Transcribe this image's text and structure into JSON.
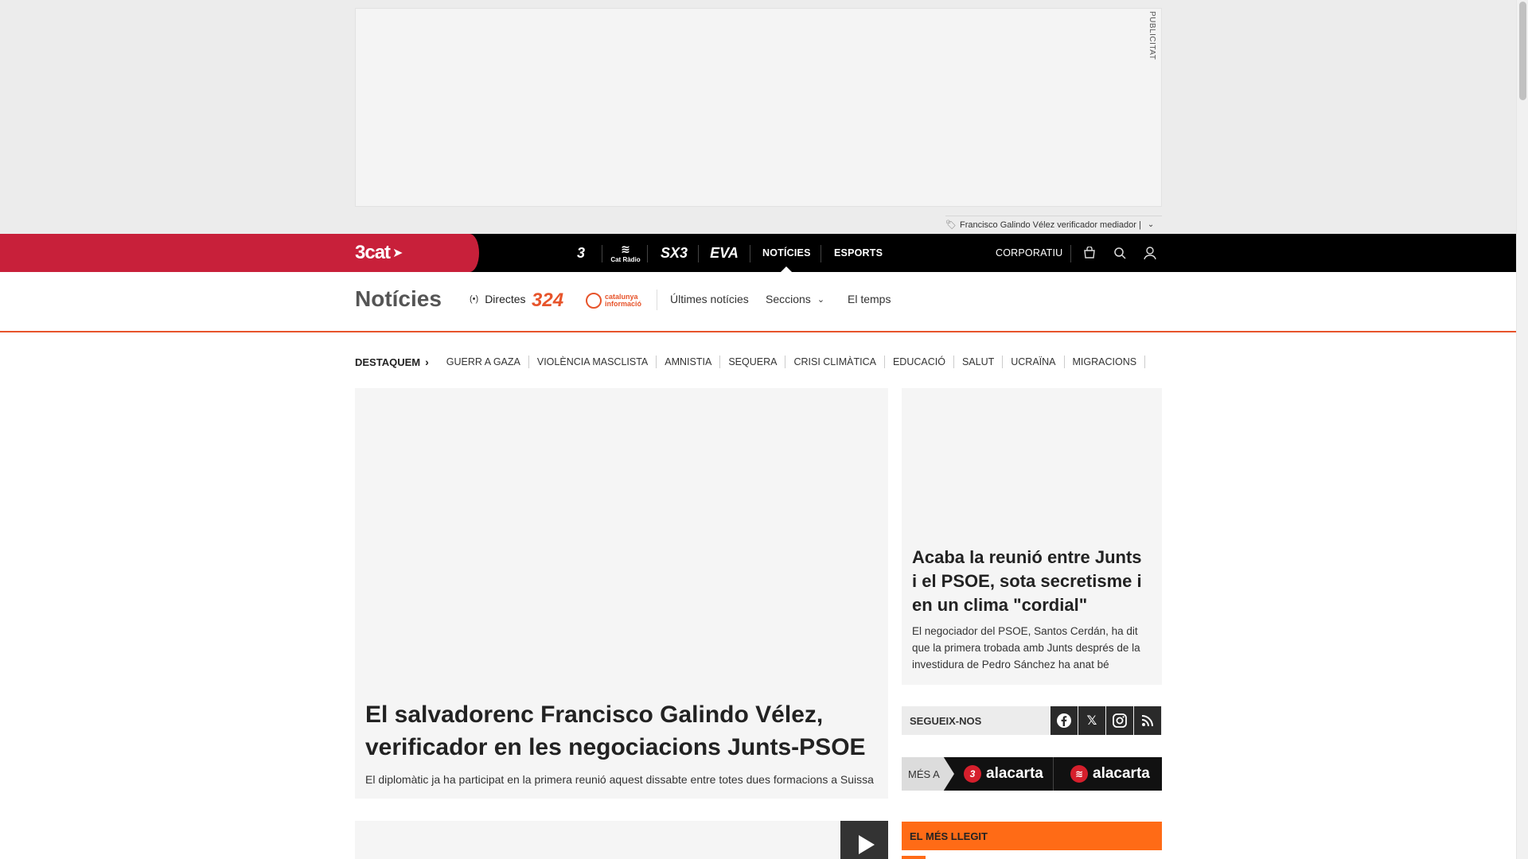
{
  "ad": {
    "label": "PUBLICITAT",
    "tag_text": "Francisco Galindo Vélez verificador mediador |",
    "tag_chevron": "chevron-down-icon"
  },
  "topnav": {
    "brand": "3cat",
    "channels": [
      "3",
      "Cat Ràdio",
      "SX3",
      "EVA"
    ],
    "links": [
      {
        "label": "NOTÍCIES",
        "active": true
      },
      {
        "label": "ESPORTS",
        "active": false
      }
    ],
    "corporate": "CORPORATIU",
    "icons": [
      "shop-icon",
      "search-icon",
      "user-icon"
    ]
  },
  "section": {
    "title": "Notícies",
    "live_label": "Directes",
    "logo_324": "324",
    "logo_ci_line1": "catalunya",
    "logo_ci_line2": "informació",
    "links": [
      "Últimes notícies",
      "Seccions",
      "El temps"
    ]
  },
  "highlights": {
    "title": "DESTAQUEM",
    "items": [
      "GUERR A GAZA",
      "VIOLÈNCIA MASCLISTA",
      "AMNISTIA",
      "SEQUERA",
      "CRISI CLIMÀTICA",
      "EDUCACIÓ",
      "SALUT",
      "UCRAÏNA",
      "MIGRACIONS"
    ]
  },
  "main_article": {
    "headline": "El salvadorenc Francisco Galindo Vélez, verificador en les negociacions Junts-PSOE",
    "summary": "El diplomàtic ja ha participat en la primera reunió aquest dissabte entre totes dues formacions a Suissa"
  },
  "side_article": {
    "headline": "Acaba la reunió entre Junts i el PSOE, sota secretisme i en un clima \"cordial\"",
    "summary": "El negociador del PSOE, Santos Cerdán, ha dit que la primera trobada amb Junts després de la investidura de Pedro Sánchez ha anat bé"
  },
  "follow": {
    "label": "SEGUEIX-NOS",
    "networks": [
      "facebook-icon",
      "x-icon",
      "instagram-icon",
      "rss-icon"
    ]
  },
  "alacarta": {
    "prefix": "MÉS A",
    "tv_label": "alacarta",
    "radio_label": "alacarta"
  },
  "most_read": {
    "label": "EL MÉS LLEGIT"
  },
  "colors": {
    "brand_red": "#c8203a",
    "accent_orange": "#ff6b16",
    "nav_black": "#000000"
  }
}
